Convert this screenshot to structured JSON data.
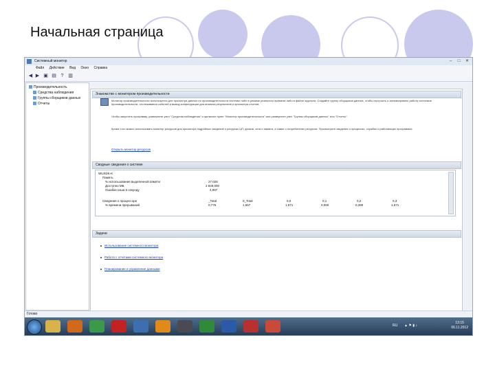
{
  "slide": {
    "title": "Начальная страница"
  },
  "window": {
    "title": "Системный монитор",
    "menu": [
      "Файл",
      "Действие",
      "Вид",
      "Окно",
      "Справка"
    ]
  },
  "tree": {
    "items": [
      "Производительность",
      "Средства наблюдения",
      "Группы сборщиков данных",
      "Отчеты"
    ]
  },
  "overview": {
    "header": "Знакомство с монитором производительности",
    "desc_1": "Монитор производительности используется для просмотра данных по производительности системы либо в режиме реального времени либо в файле журнала. Создайте группу сборщиков данных, чтобы настроить и запланировать работу счетчиков производительности, отслеживания событий и вывод конфигурации для анализа результатов и просмотра отчетов.",
    "desc_2": "Чтобы запустить программу, разверните узел \"Средства наблюдения\" и щелкните пункт \"Монитор производительности\" или разверните узел \"Группы сборщиков данных\" или \"Отчеты\".",
    "desc_3": "Кроме того можно использовать монитор ресурсов для просмотра подробных сведений о ресурсах ЦП, дисков, сети и памяти, а также о потребителях ресурсов. Просмотрите сведения о процессах, службах и работающих программах.",
    "link": "Открыть монитор ресурсов"
  },
  "summary": {
    "header": "Сводные сведения о системе",
    "machine": "WUSDK-K",
    "memory": "Память",
    "rows": [
      {
        "label": "% использования выделенной памяти",
        "value": "27,028"
      },
      {
        "label": "Доступно МБ",
        "value": "2 849,000"
      },
      {
        "label": "Ошибки кэша в секунду",
        "value": "4,997"
      }
    ],
    "cpu_header": "Сведения о процессоре",
    "cpu_cols": [
      "_Total",
      "0_Total",
      "0,0",
      "0,1",
      "0,2",
      "0,3"
    ],
    "cpu_label": "% времени прерываний",
    "cpu_values": [
      "0,776",
      "1,557",
      "1,571",
      "0,000",
      "0,390",
      "1,571"
    ]
  },
  "tasks": {
    "header": "Задачи",
    "items": [
      "Использование системного монитора",
      "Работа с отчетами системного монитора",
      "Планирование и управление данными"
    ]
  },
  "status": {
    "text": "Готово"
  },
  "clock": {
    "time": "13:15",
    "date": "06.11.2012"
  },
  "tray": {
    "lang": "RU"
  }
}
